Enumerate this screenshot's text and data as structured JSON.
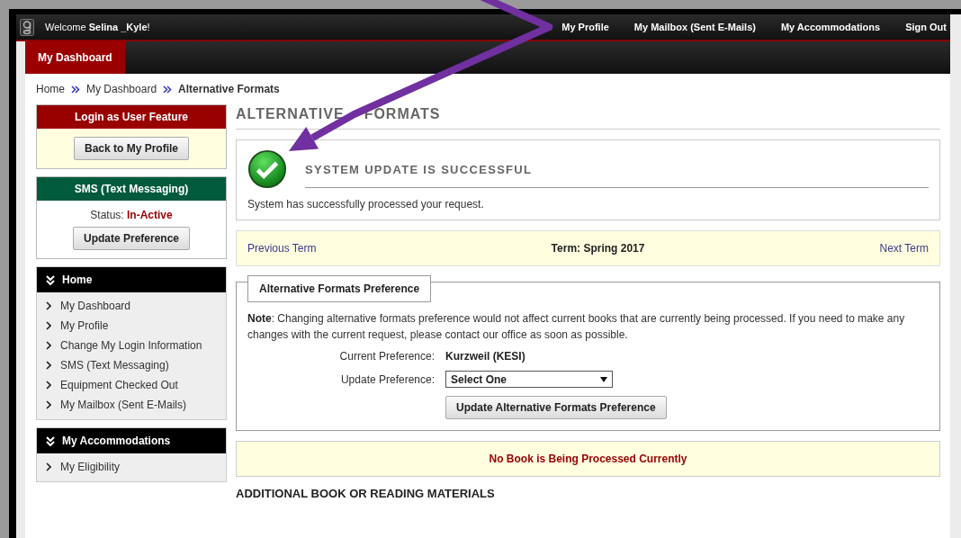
{
  "top_bar": {
    "welcome": "Welcome **Selina _Kyle**!",
    "links": [
      "My Profile",
      "My Mailbox (Sent E-Mails)",
      "My Accommodations",
      "Sign Out"
    ]
  },
  "nav_tabs": [
    {
      "label": "My Dashboard",
      "selected": true
    }
  ],
  "breadcrumb": [
    "Home",
    "My Dashboard",
    "Alternative Formats"
  ],
  "sidebar": {
    "login_panel": {
      "title": "Login as User Feature",
      "button": "Back to My Profile"
    },
    "sms_panel": {
      "title": "SMS (Text Messaging)",
      "status_label": "Status:",
      "status_value": "In-Active",
      "button": "Update Preference"
    },
    "menus": [
      {
        "title": "Home",
        "items": [
          "My Dashboard",
          "My Profile",
          "Change My Login Information",
          "SMS (Text Messaging)",
          "Equipment Checked Out",
          "My Mailbox (Sent E-Mails)"
        ]
      },
      {
        "title": "My Accommodations",
        "items": [
          "My Eligibility"
        ]
      }
    ]
  },
  "content": {
    "heading_words": [
      "ALTERNATIVE",
      "FORMATS"
    ],
    "success": {
      "title": "SYSTEM UPDATE IS SUCCESSFUL",
      "message": "System has successfully processed your request."
    },
    "term_bar": {
      "previous": "Previous Term",
      "term": "Term: Spring 2017",
      "next": "Next Term"
    },
    "preference": {
      "legend": "Alternative Formats Preference",
      "note": "**Note**: Changing alternative formats preference would not affect current books that are currently being processed. If you need to make any changes with the current request, please contact our office as soon as possible.",
      "current_label": "Current Preference:",
      "current_value": "Kurzweil (KESI)",
      "update_label": "Update Preference:",
      "select_value": "Select One",
      "button": "Update Alternative Formats Preference"
    },
    "notice": "No Book is Being Processed Currently",
    "next_heading": "ADDITIONAL BOOK OR READING MATERIALS"
  }
}
